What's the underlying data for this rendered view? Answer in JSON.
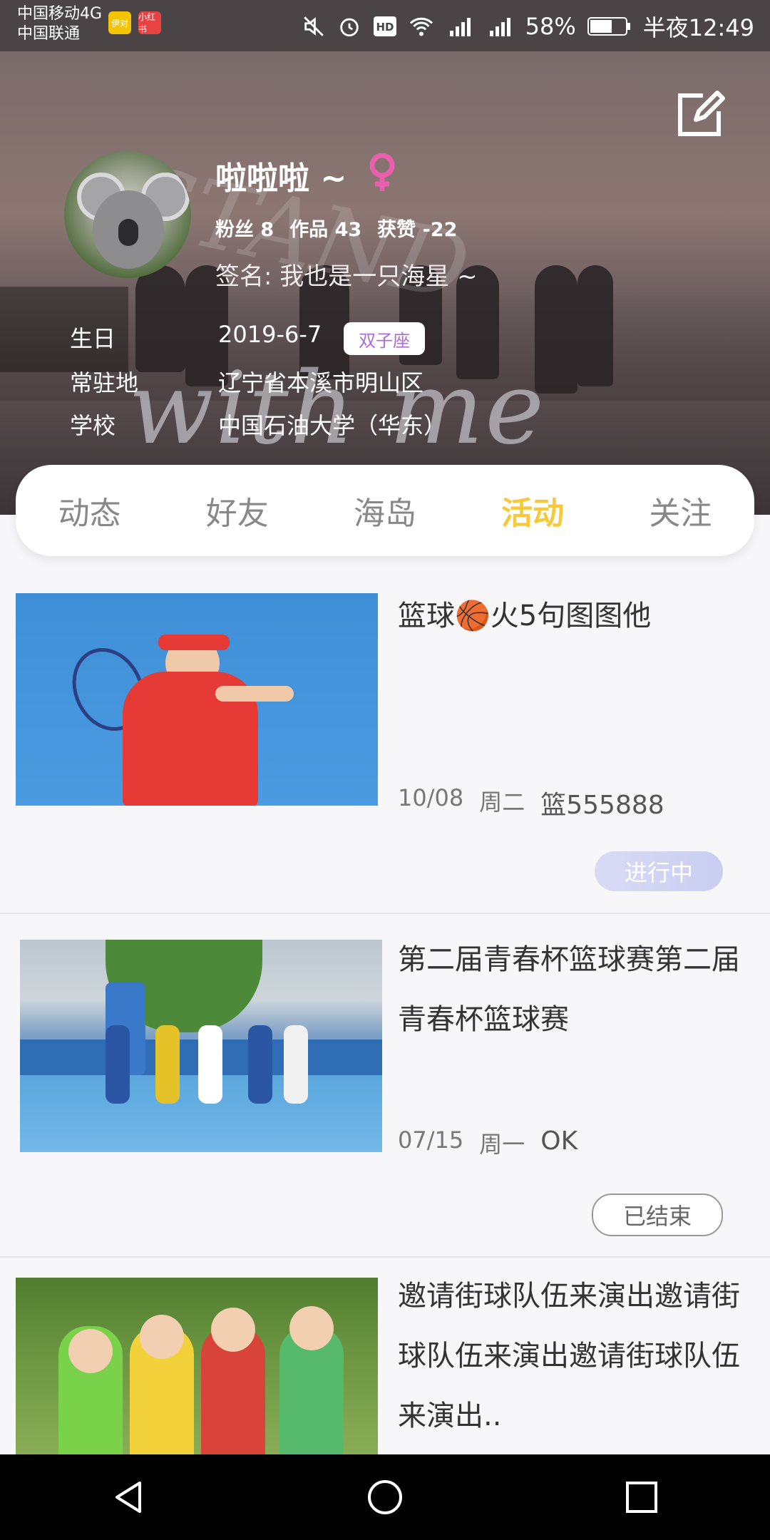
{
  "status_bar": {
    "carrier1": "中国移动4G",
    "carrier2": "中国联通",
    "battery": "58%",
    "time": "半夜12:49",
    "apps": [
      "伊对",
      "小红书"
    ]
  },
  "profile": {
    "name": "啦啦啦 ~",
    "gender_icon": "female-icon",
    "stats": {
      "fans": "粉丝 8",
      "works": "作品 43",
      "likes": "获赞 -22"
    },
    "signature": "签名: 我也是一只海星 ~",
    "birthday_label": "生日",
    "birthday": "2019-6-7",
    "zodiac": "双子座",
    "residence_label": "常驻地",
    "residence": "辽宁省本溪市明山区",
    "school_label": "学校",
    "school": "中国石油大学（华东）",
    "background_text": "with me",
    "background_text2": "STAND"
  },
  "tabs": [
    {
      "label": "动态",
      "active": false
    },
    {
      "label": "好友",
      "active": false
    },
    {
      "label": "海岛",
      "active": false
    },
    {
      "label": "活动",
      "active": true
    },
    {
      "label": "关注",
      "active": false
    }
  ],
  "activities": [
    {
      "title": "篮球🏀火5句图图他",
      "date": "10/08",
      "weekday": "周二",
      "code": "篮555888",
      "status": "进行中"
    },
    {
      "title": "第二届青春杯篮球赛第二届青春杯篮球赛",
      "date": "07/15",
      "weekday": "周一",
      "code": "OK",
      "status": "已结束"
    },
    {
      "title": "邀请街球队伍来演出邀请街球队伍来演出邀请街球队伍来演出..",
      "date": "",
      "weekday": "",
      "code": "",
      "status": ""
    }
  ],
  "colors": {
    "active_tab": "#f7c93a",
    "ongoing_badge": "#c9cdf0",
    "zodiac_text": "#b069d9",
    "gender_pink": "#e95fae"
  }
}
